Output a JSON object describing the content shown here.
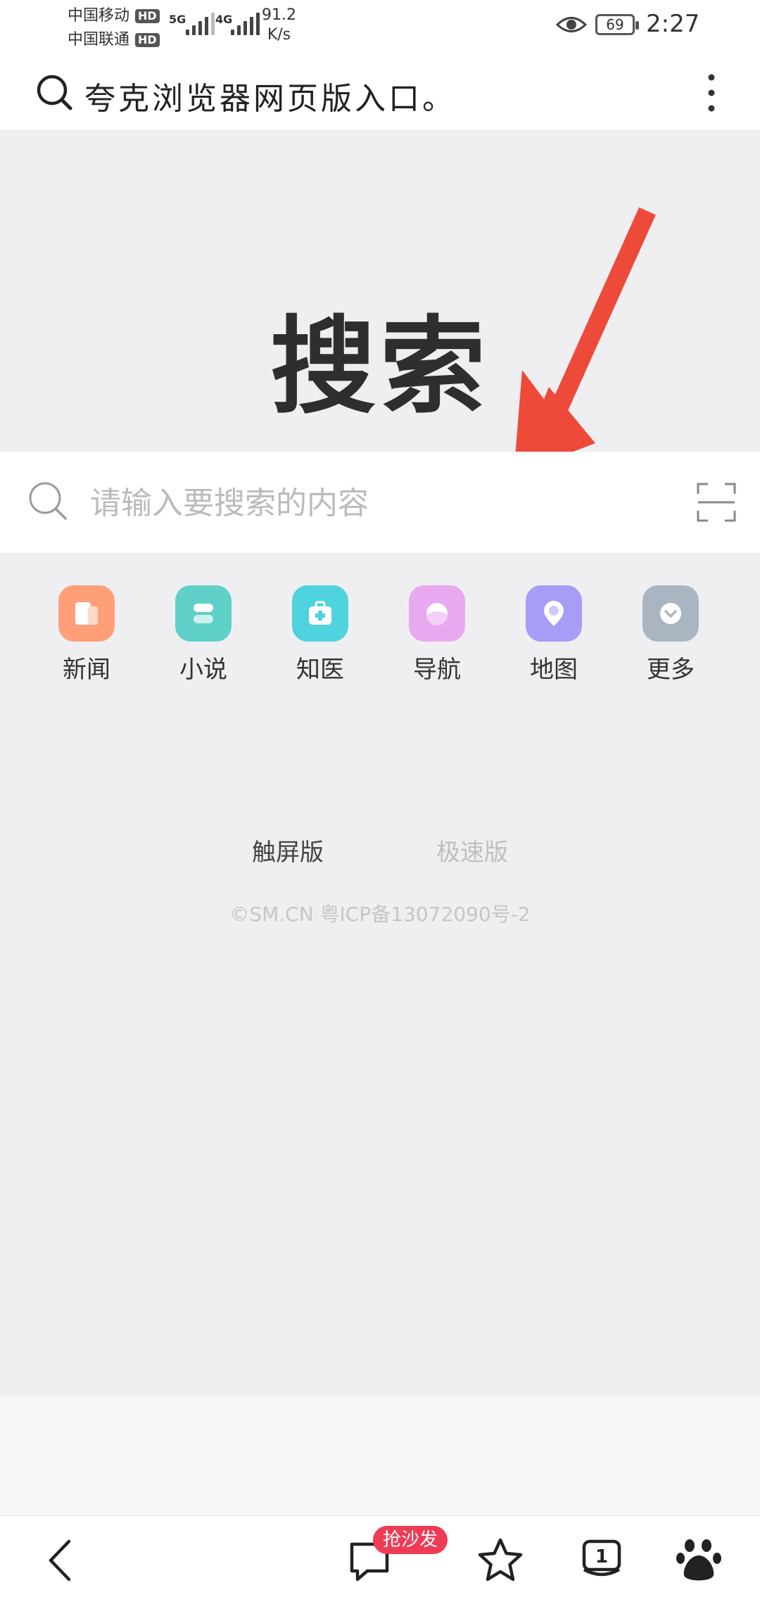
{
  "status_bar": {
    "carrier1": "中国移动",
    "carrier2": "中国联通",
    "hd": "HD",
    "net1": "5G",
    "net2": "4G",
    "speed_value": "91.2",
    "speed_unit": "K/s",
    "battery": "69",
    "time": "2:27"
  },
  "address_bar": {
    "text": "夸克浏览器网页版入口。"
  },
  "hero": {
    "title": "搜索"
  },
  "search": {
    "placeholder": "请输入要搜索的内容"
  },
  "shortcuts": [
    {
      "label": "新闻",
      "color": "#ff9f7a"
    },
    {
      "label": "小说",
      "color": "#5fd0c8"
    },
    {
      "label": "知医",
      "color": "#4fd3de"
    },
    {
      "label": "导航",
      "color": "#e8a9f0"
    },
    {
      "label": "地图",
      "color": "#a79cf6"
    },
    {
      "label": "更多",
      "color": "#a9b6c2"
    }
  ],
  "versions": {
    "touch": "触屏版",
    "fast": "极速版"
  },
  "footer": {
    "copyright": "©SM.CN 粤ICP备13072090号-2"
  },
  "bottom_nav": {
    "comment_badge": "抢沙发",
    "tab_count": "1"
  },
  "colors": {
    "arrow": "#ee4a3a",
    "badge": "#ef3b55"
  }
}
